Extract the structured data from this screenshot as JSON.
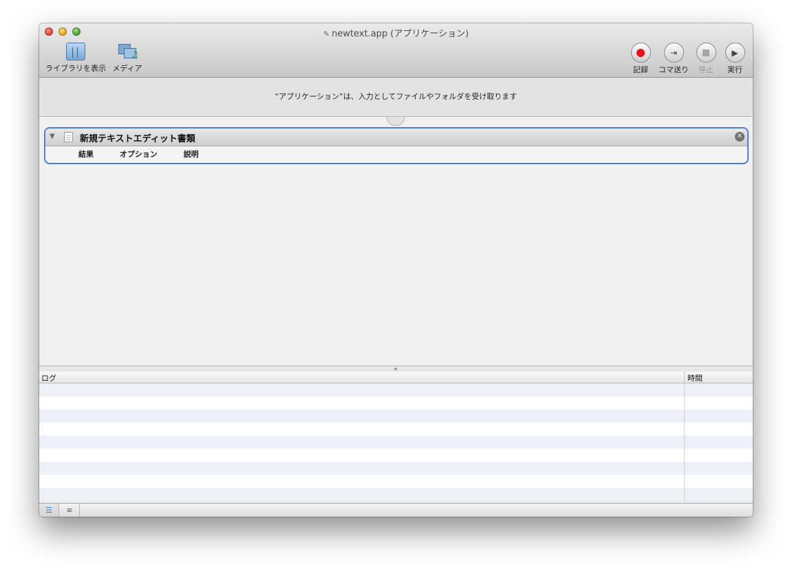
{
  "window": {
    "title": "newtext.app (アプリケーション)"
  },
  "toolbar": {
    "library_label": "ライブラリを表示",
    "media_label": "メディア",
    "record_label": "記録",
    "step_label": "コマ送り",
    "stop_label": "停止",
    "run_label": "実行"
  },
  "info_message": "“アプリケーション”は、入力としてファイルやフォルダを受け取ります",
  "action": {
    "title": "新規テキストエディット書類",
    "tabs": [
      "結果",
      "オプション",
      "説明"
    ]
  },
  "log": {
    "columns": [
      "ログ",
      "時間"
    ],
    "row_count_visible": 9
  }
}
